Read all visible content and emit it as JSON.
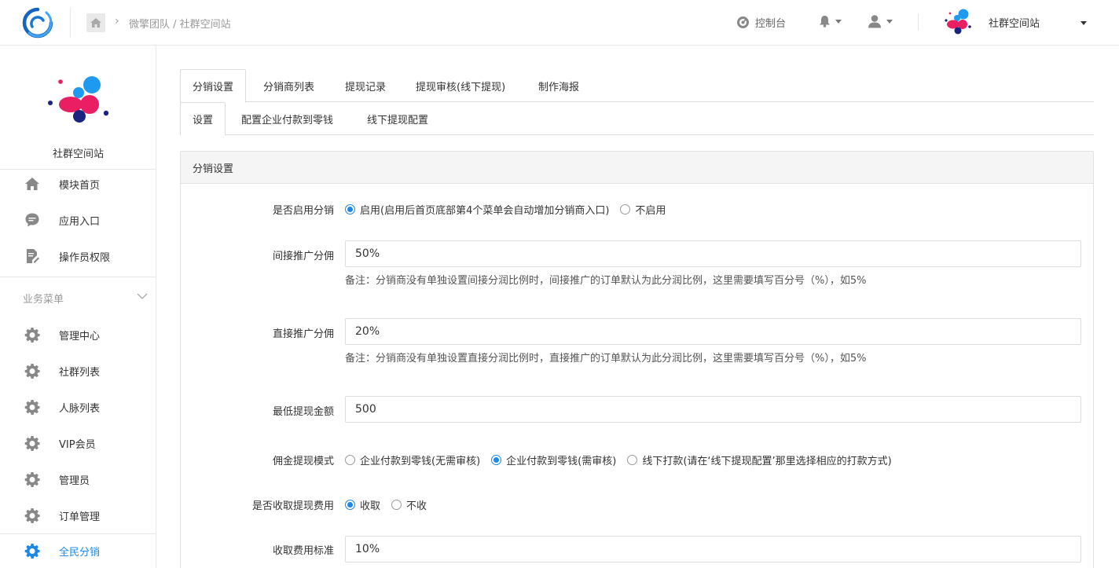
{
  "topbar": {
    "breadcrumb": "微擎团队 / 社群空间站",
    "console_label": "控制台",
    "site_name": "社群空间站"
  },
  "sidebar": {
    "brand_name": "社群空间站",
    "items_top": [
      {
        "label": "模块首页",
        "icon": "home-icon"
      },
      {
        "label": "应用入口",
        "icon": "chat-icon"
      },
      {
        "label": "操作员权限",
        "icon": "edit-doc-icon"
      }
    ],
    "group_title": "业务菜单",
    "items_business": [
      {
        "label": "管理中心",
        "icon": "gear-icon"
      },
      {
        "label": "社群列表",
        "icon": "gear-icon"
      },
      {
        "label": "人脉列表",
        "icon": "gear-icon"
      },
      {
        "label": "VIP会员",
        "icon": "gear-icon"
      },
      {
        "label": "管理员",
        "icon": "gear-icon"
      },
      {
        "label": "订单管理",
        "icon": "gear-icon"
      },
      {
        "label": "全民分销",
        "icon": "gear-icon",
        "active": true
      }
    ]
  },
  "tabs_primary": [
    "分销设置",
    "分销商列表",
    "提现记录",
    "提现审核(线下提现)",
    "制作海报"
  ],
  "tabs_secondary": [
    "设置",
    "配置企业付款到零钱",
    "线下提现配置"
  ],
  "panel": {
    "title": "分销设置",
    "enable": {
      "label": "是否启用分销",
      "options": [
        "启用(启用后首页底部第4个菜单会自动增加分销商入口)",
        "不启用"
      ],
      "selected": 0
    },
    "indirect": {
      "label": "间接推广分佣",
      "value": "50%",
      "note": "备注：分销商没有单独设置间接分润比例时，间接推广的订单默认为此分润比例，这里需要填写百分号（%），如5%"
    },
    "direct": {
      "label": "直接推广分佣",
      "value": "20%",
      "note": "备注：分销商没有单独设置直接分润比例时，直接推广的订单默认为此分润比例，这里需要填写百分号（%），如5%"
    },
    "min_withdraw": {
      "label": "最低提现金额",
      "value": "500"
    },
    "withdraw_mode": {
      "label": "佣金提现模式",
      "options": [
        "企业付款到零钱(无需审核)",
        "企业付款到零钱(需审核)",
        "线下打款(请在‘线下提现配置’那里选择相应的打款方式)"
      ],
      "selected": 1
    },
    "fee": {
      "label": "是否收取提现费用",
      "options": [
        "收取",
        "不收"
      ],
      "selected": 0
    },
    "fee_rate": {
      "label": "收取费用标准",
      "value": "10%"
    }
  },
  "colors": {
    "accent": "#1e88e5",
    "brand_pink": "#e91e63",
    "brand_blue": "#1e9bf0",
    "brand_navy": "#1a237e"
  }
}
